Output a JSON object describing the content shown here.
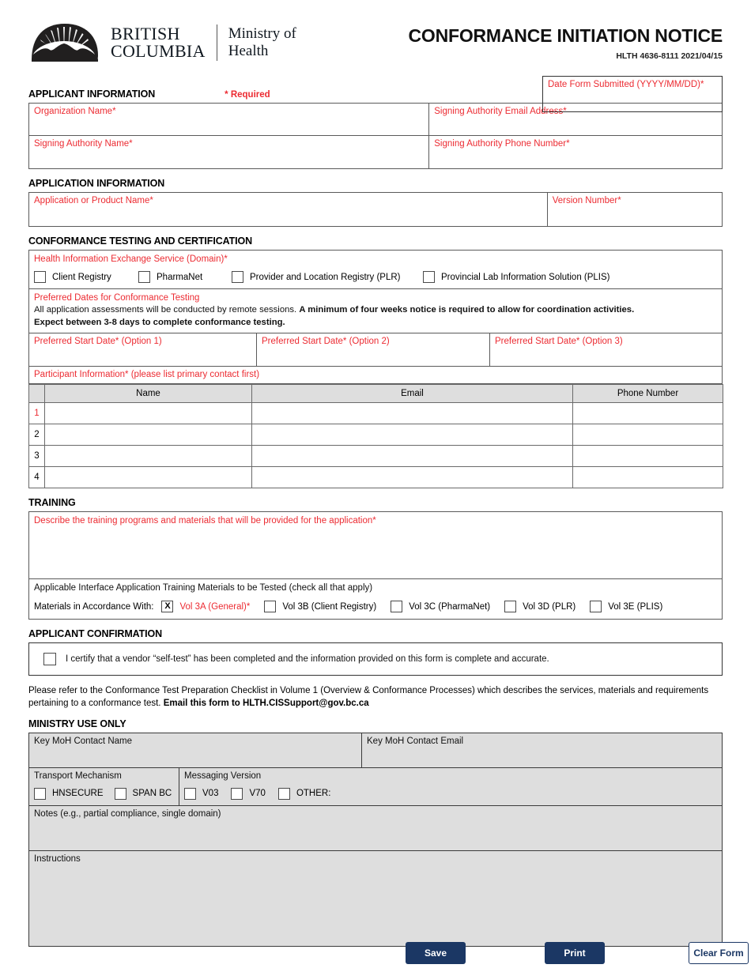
{
  "header": {
    "brand_line1": "BRITISH",
    "brand_line2": "COLUMBIA",
    "ministry_line1": "Ministry of",
    "ministry_line2": "Health",
    "title": "CONFORMANCE INITIATION NOTICE",
    "form_id": "HLTH 4636-8111  2021/04/15"
  },
  "date_submitted": {
    "label": "Date Form Submitted (YYYY/MM/DD)*",
    "value": ""
  },
  "applicant": {
    "heading": "APPLICANT INFORMATION",
    "required_note": "* Required",
    "org_name_label": "Organization Name*",
    "org_name_value": "",
    "signing_email_label": "Signing Authority Email Address*",
    "signing_email_value": "",
    "signing_name_label": "Signing Authority Name*",
    "signing_name_value": "",
    "signing_phone_label": "Signing Authority Phone Number*",
    "signing_phone_value": ""
  },
  "application": {
    "heading": "APPLICATION INFORMATION",
    "product_name_label": "Application or Product Name*",
    "product_name_value": "",
    "version_label": "Version Number*",
    "version_value": ""
  },
  "conformance": {
    "heading": "CONFORMANCE TESTING AND CERTIFICATION",
    "domain_label": "Health Information Exchange Service (Domain)*",
    "domains": [
      {
        "label": "Client Registry",
        "checked": false
      },
      {
        "label": "PharmaNet",
        "checked": false
      },
      {
        "label": "Provider and Location Registry (PLR)",
        "checked": false
      },
      {
        "label": "Provincial Lab Information Solution (PLIS)",
        "checked": false
      }
    ],
    "preferred_dates_label": "Preferred Dates for Conformance Testing",
    "note_part1": "All application assessments will be conducted by remote sessions. ",
    "note_bold1": "A minimum of four weeks notice is required to allow for coordination activities.",
    "note_bold2": "Expect between 3-8 days to complete conformance testing.",
    "date_options": [
      {
        "label": "Preferred Start Date* (Option 1)",
        "value": ""
      },
      {
        "label": "Preferred Start Date* (Option 2)",
        "value": ""
      },
      {
        "label": "Preferred Start Date* (Option 3)",
        "value": ""
      }
    ],
    "participant_label": "Participant Information* (please list primary contact first)",
    "participant_columns": [
      "",
      "Name",
      "Email",
      "Phone Number"
    ],
    "participant_rows": [
      {
        "num": "1",
        "name": "",
        "email": "",
        "phone": ""
      },
      {
        "num": "2",
        "name": "",
        "email": "",
        "phone": ""
      },
      {
        "num": "3",
        "name": "",
        "email": "",
        "phone": ""
      },
      {
        "num": "4",
        "name": "",
        "email": "",
        "phone": ""
      }
    ]
  },
  "training": {
    "heading": "TRAINING",
    "describe_label": "Describe the training programs and materials that will be provided for the application*",
    "describe_value": "",
    "materials_label": "Applicable Interface Application Training Materials to be Tested (check all that apply)",
    "materials_lead": "Materials in Accordance With:",
    "materials": [
      {
        "label": "Vol 3A (General)*",
        "checked": true,
        "mark": "X",
        "red": true
      },
      {
        "label": "Vol 3B (Client Registry)",
        "checked": false,
        "mark": "",
        "red": false
      },
      {
        "label": "Vol 3C (PharmaNet)",
        "checked": false,
        "mark": "",
        "red": false
      },
      {
        "label": "Vol 3D (PLR)",
        "checked": false,
        "mark": "",
        "red": false
      },
      {
        "label": "Vol 3E (PLIS)",
        "checked": false,
        "mark": "",
        "red": false
      }
    ]
  },
  "confirmation": {
    "heading": "APPLICANT CONFIRMATION",
    "certify_label": "I certify that a vendor “self-test” has been completed and the information provided on this form is complete and accurate.",
    "certify_checked": false,
    "footer_text": "Please refer to the Conformance Test Preparation Checklist in Volume 1 (Overview & Conformance Processes) which describes the services, materials and requirements pertaining to a conformance test. ",
    "footer_bold": "Email this form to HLTH.CISSupport@gov.bc.ca"
  },
  "ministry": {
    "heading": "MINISTRY USE ONLY",
    "contact_name_label": "Key MoH Contact Name",
    "contact_name_value": "",
    "contact_email_label": "Key MoH Contact Email",
    "contact_email_value": "",
    "transport_label": "Transport Mechanism",
    "transport_options": [
      {
        "label": "HNSECURE",
        "checked": false
      },
      {
        "label": "SPAN BC",
        "checked": false
      }
    ],
    "messaging_label": "Messaging Version",
    "messaging_options": [
      {
        "label": "V03",
        "checked": false
      },
      {
        "label": "V70",
        "checked": false
      },
      {
        "label": "OTHER:",
        "checked": false
      }
    ],
    "notes_label": "Notes (e.g., partial compliance, single domain)",
    "notes_value": "",
    "instructions_label": "Instructions",
    "instructions_value": ""
  },
  "buttons": {
    "save": "Save",
    "print": "Print",
    "clear": "Clear Form"
  },
  "colors": {
    "required_red": "#ec2b32",
    "button_navy": "#1b3764",
    "ministry_gray": "#dedede"
  }
}
